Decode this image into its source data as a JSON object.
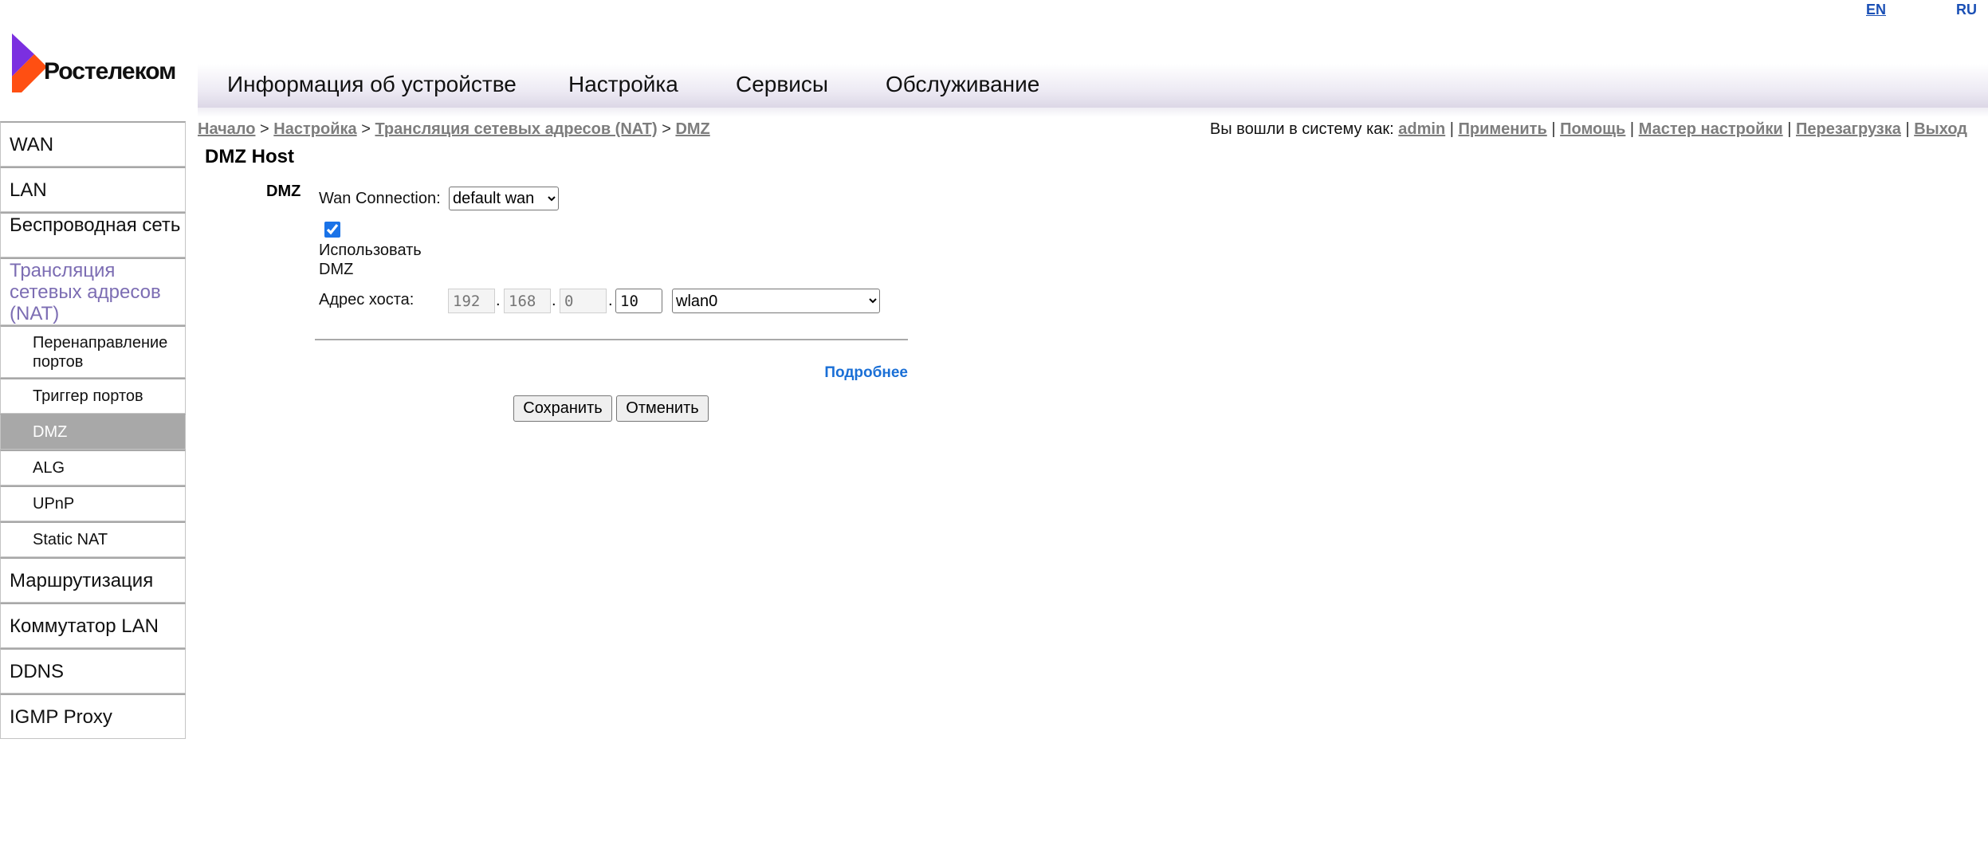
{
  "lang": {
    "en": "EN",
    "ru": "RU"
  },
  "brand": {
    "name": "Ростелеком"
  },
  "topnav": [
    "Информация об устройстве",
    "Настройка",
    "Сервисы",
    "Обслуживание"
  ],
  "sidebar": {
    "items": [
      {
        "label": "WAN"
      },
      {
        "label": "LAN"
      },
      {
        "label": "Беспроводная сеть"
      },
      {
        "label": "Трансляция сетевых адресов (NAT)"
      },
      {
        "label": "Перенаправление портов"
      },
      {
        "label": "Триггер портов"
      },
      {
        "label": "DMZ"
      },
      {
        "label": "ALG"
      },
      {
        "label": "UPnP"
      },
      {
        "label": "Static NAT"
      },
      {
        "label": "Маршрутизация"
      },
      {
        "label": "Коммутатор LAN"
      },
      {
        "label": "DDNS"
      },
      {
        "label": "IGMP Proxy"
      }
    ]
  },
  "breadcrumb": {
    "items": [
      "Начало",
      "Настройка",
      "Трансляция сетевых адресов (NAT)",
      "DMZ"
    ],
    "separator": ">"
  },
  "userbar": {
    "prefix": "Вы вошли в систему как:",
    "user": "admin",
    "links": [
      "Применить",
      "Помощь",
      "Мастер настройки",
      "Перезагрузка",
      "Выход"
    ],
    "separator": "|"
  },
  "main": {
    "title": "DMZ Host",
    "section_label": "DMZ",
    "wan_connection_label": "Wan Connection:",
    "wan_connection_value": "default wan",
    "use_dmz_label": "Использовать DMZ",
    "use_dmz_checked": true,
    "host_address_label": "Адрес хоста:",
    "ip": [
      "192",
      "168",
      "0",
      "10"
    ],
    "interface_value": "wlan0",
    "more_link": "Подробнее",
    "save_button": "Сохранить",
    "cancel_button": "Отменить"
  },
  "colors": {
    "accent_link": "#1a6fd6",
    "active_item": "#a8a8a8",
    "nat_text": "#7c6db3"
  }
}
